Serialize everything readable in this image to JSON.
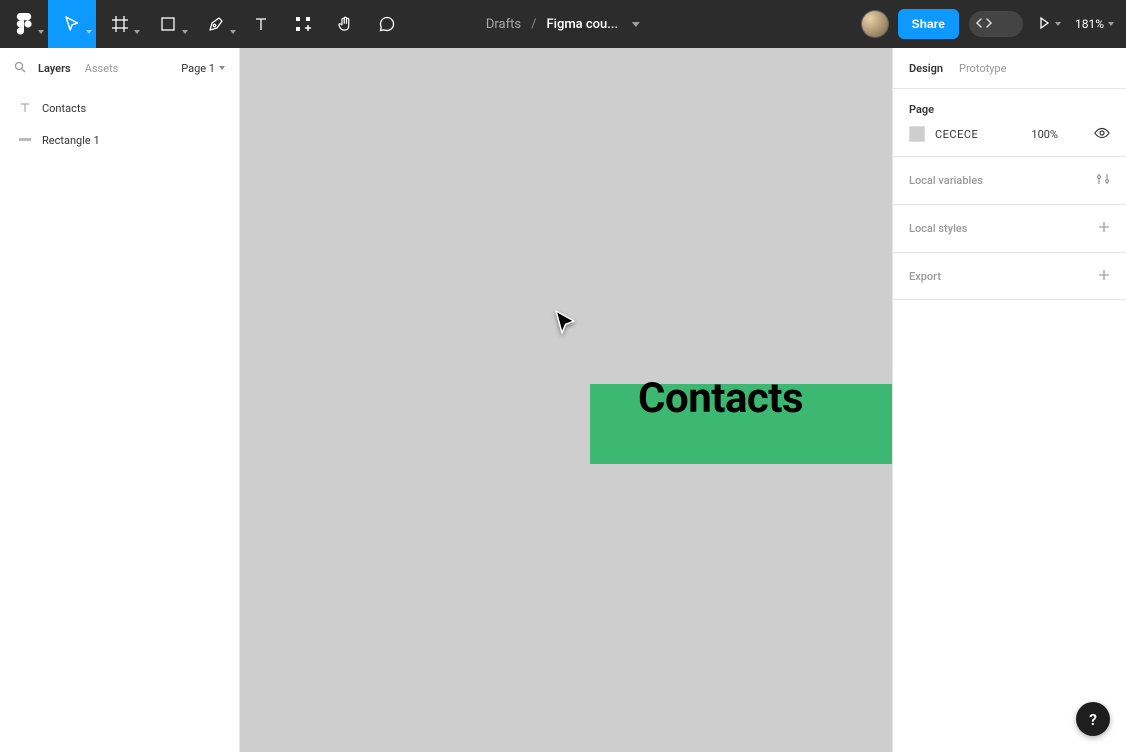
{
  "breadcrumb": {
    "folder": "Drafts",
    "file": "Figma cou..."
  },
  "toolbar": {
    "share_label": "Share",
    "zoom": "181%"
  },
  "left": {
    "tab_layers": "Layers",
    "tab_assets": "Assets",
    "page_label": "Page 1",
    "layers": [
      {
        "name": "Contacts",
        "kind": "text"
      },
      {
        "name": "Rectangle 1",
        "kind": "rect"
      }
    ]
  },
  "canvas": {
    "text": "Contacts"
  },
  "right": {
    "tab_design": "Design",
    "tab_prototype": "Prototype",
    "page_label": "Page",
    "bg_hex": "CECECE",
    "bg_opacity": "100%",
    "local_variables": "Local variables",
    "local_styles": "Local styles",
    "export": "Export"
  },
  "help_label": "?"
}
